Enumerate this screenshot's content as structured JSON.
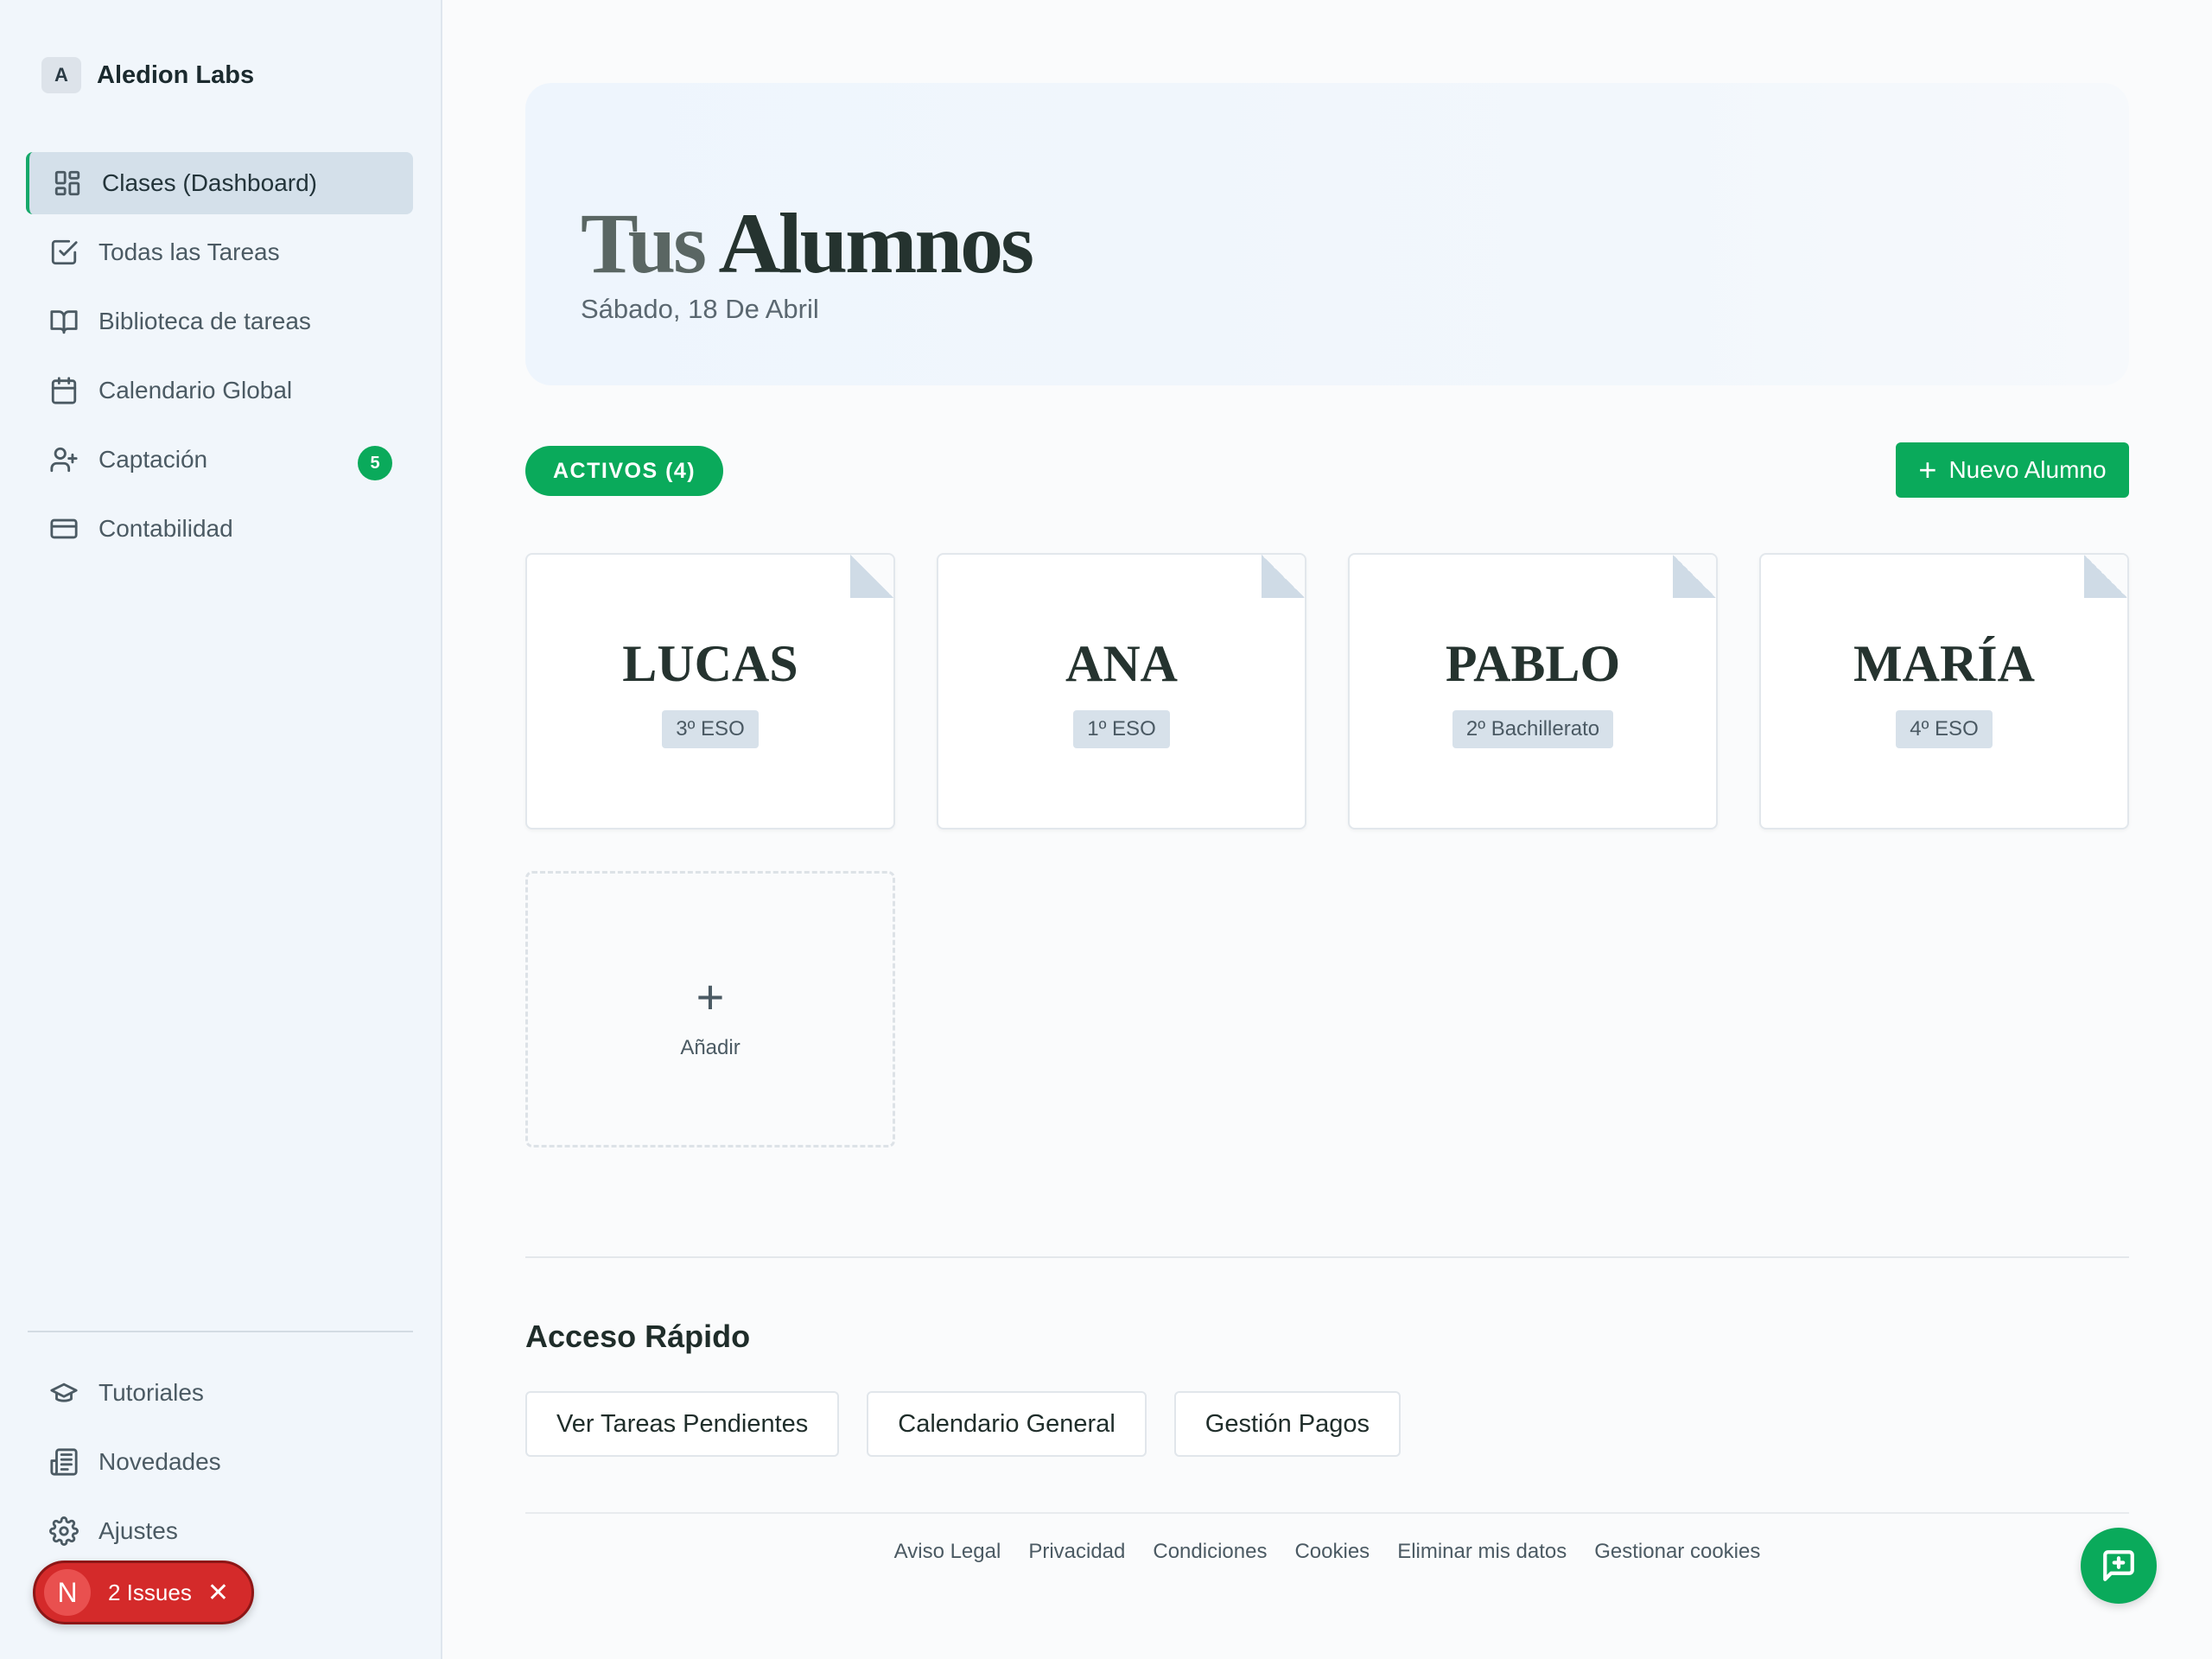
{
  "brand": {
    "logo_letter": "A",
    "name": "Aledion Labs"
  },
  "sidebar": {
    "items": [
      {
        "label": "Clases (Dashboard)",
        "icon": "dashboard-icon",
        "active": true
      },
      {
        "label": "Todas las Tareas",
        "icon": "check-square-icon"
      },
      {
        "label": "Biblioteca de tareas",
        "icon": "book-open-icon"
      },
      {
        "label": "Calendario Global",
        "icon": "calendar-icon"
      },
      {
        "label": "Captación",
        "icon": "user-plus-icon",
        "badge": "5"
      },
      {
        "label": "Contabilidad",
        "icon": "credit-card-icon"
      }
    ],
    "bottom_items": [
      {
        "label": "Tutoriales",
        "icon": "graduation-cap-icon"
      },
      {
        "label": "Novedades",
        "icon": "newspaper-icon"
      },
      {
        "label": "Ajustes",
        "icon": "gear-icon"
      }
    ]
  },
  "issues_pill": {
    "letter": "N",
    "label": "2 Issues",
    "close": "✕"
  },
  "hero": {
    "title_light": "Tus",
    "title_bold": "Alumnos",
    "date": "Sábado, 18 De Abril"
  },
  "filter": {
    "active_tab": "ACTIVOS (4)"
  },
  "actions": {
    "new_student": "Nuevo Alumno",
    "new_student_icon": "+"
  },
  "students": [
    {
      "name": "LUCAS",
      "level": "3º ESO"
    },
    {
      "name": "ANA",
      "level": "1º ESO"
    },
    {
      "name": "PABLO",
      "level": "2º Bachillerato"
    },
    {
      "name": "MARÍA",
      "level": "4º ESO"
    }
  ],
  "add_card": {
    "icon": "+",
    "label": "Añadir"
  },
  "quick_access": {
    "title": "Acceso Rápido",
    "buttons": [
      "Ver Tareas Pendientes",
      "Calendario General",
      "Gestión Pagos"
    ]
  },
  "footer": {
    "links": [
      "Aviso Legal",
      "Privacidad",
      "Condiciones",
      "Cookies",
      "Eliminar mis datos",
      "Gestionar cookies"
    ]
  },
  "colors": {
    "accent": "#0aaa5b",
    "issues": "#d42a2a",
    "sidebar_bg": "#f1f6fb"
  }
}
